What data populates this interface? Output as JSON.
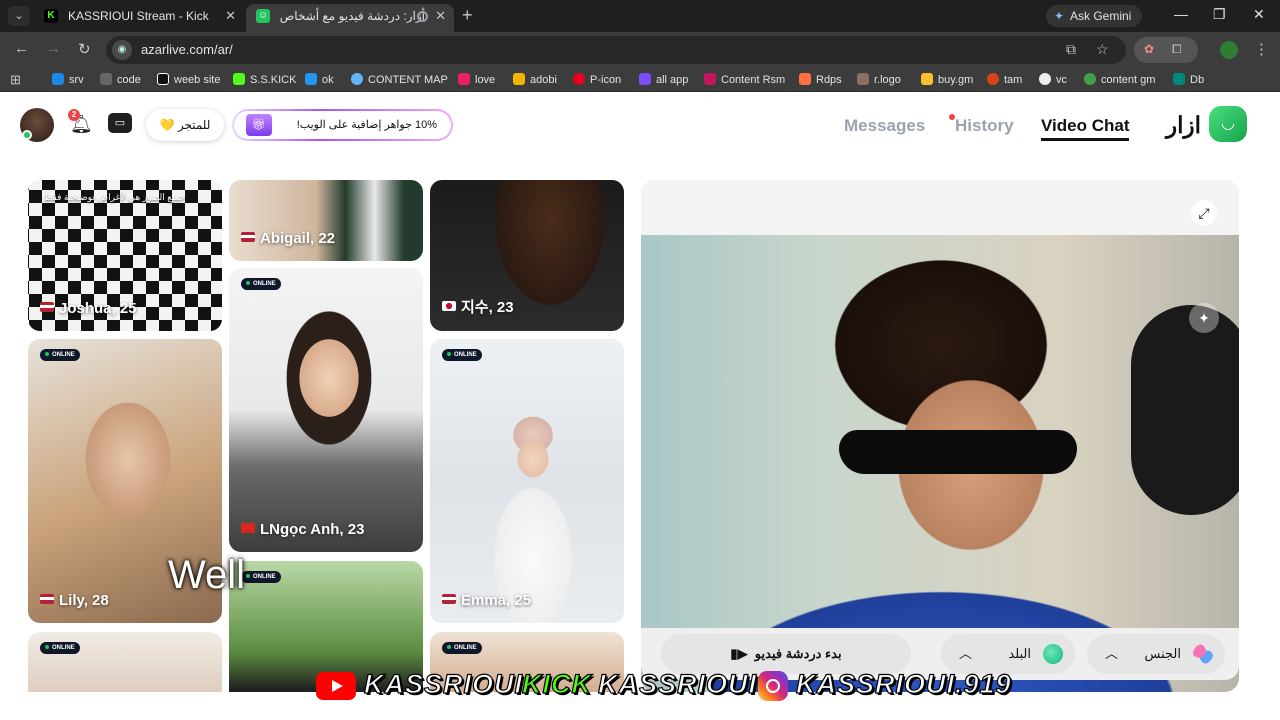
{
  "browser": {
    "tabs": [
      {
        "title": "KASSRIOUI Stream - Kick Dashb",
        "favicon": "kick-favicon",
        "color": "#53fc18"
      },
      {
        "title": "أزار: دردشة فيديو مع أشخاص -",
        "favicon": "azar-favicon",
        "color": "#22c55e"
      }
    ],
    "ask_gemini": "Ask Gemini",
    "url": "azarlive.com/ar/",
    "bookmarks": [
      "srv",
      "code",
      "weeb site",
      "S.S.KICK",
      "ok",
      "CONTENT MAP",
      "love",
      "adobi",
      "P-icon",
      "all app",
      "Content Rsm",
      "Rdps",
      "r.logo",
      "buy.gm",
      "tam",
      "vc",
      "content gm",
      "Db"
    ]
  },
  "header": {
    "notification_count": "2",
    "store_label": "للمتجر 💛",
    "promo_text": "10% جواهر إضافية على الويب!",
    "nav": {
      "messages": "Messages",
      "history": "History",
      "video_chat": "Video Chat"
    },
    "brand": "ازار"
  },
  "grid": {
    "note": "جميع الصور هي لأغراض توضيحية فقط",
    "online_label": "ONLINE",
    "cards": [
      {
        "name": "Joshua, 25",
        "flag": "us-flag"
      },
      {
        "name": "Abigail, 22",
        "flag": "us-flag"
      },
      {
        "name": "지수, 23",
        "flag": "kr-flag"
      },
      {
        "name": "Lily, 28",
        "flag": "us-flag"
      },
      {
        "name": "LNgọc Anh, 23",
        "flag": "vn-flag"
      },
      {
        "name": "Emma, 25",
        "flag": "us-flag"
      }
    ]
  },
  "video": {
    "start_label": "بدء دردشة فيديو",
    "country_label": "البلد",
    "gender_label": "الجنس"
  },
  "overlay": {
    "caption": "Well",
    "watermark": {
      "yt_name": "KASSRIOUI",
      "kick_word": "KICK",
      "kick_name": "KASSRIOUI",
      "ig_name": "KASSRIOUI.919"
    }
  },
  "colors": {
    "accent_green": "#22c55e",
    "kick_green": "#53fc18",
    "online_badge_bg": "#0f172a"
  }
}
